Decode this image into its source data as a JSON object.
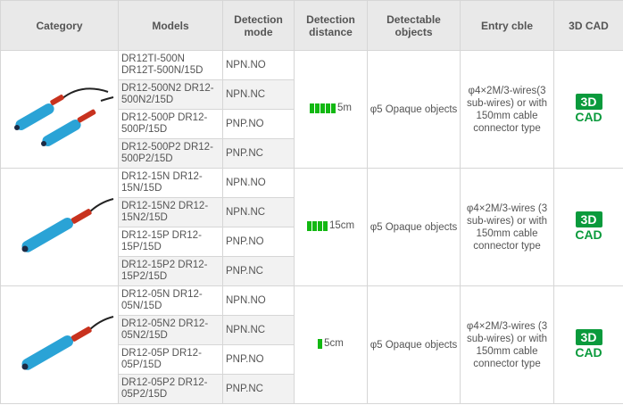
{
  "headers": {
    "category": "Category",
    "models": "Models",
    "mode": "Detection mode",
    "distance": "Detection distance",
    "objects": "Detectable objects",
    "entry": "Entry cble",
    "cad": "3D CAD"
  },
  "groups": [
    {
      "distance": "5m",
      "bar_level": 5,
      "objects": "φ5 Opaque objects",
      "entry": "φ4×2M/3-wires(3 sub-wires) or with 150mm cable connector type",
      "cad_top": "3D",
      "cad_bottom": "CAD",
      "rows": [
        {
          "model": "DR12TI-500N DR12T-500N/15D",
          "mode": "NPN.NO"
        },
        {
          "model": "DR12-500N2 DR12-500N2/15D",
          "mode": "NPN.NC"
        },
        {
          "model": "DR12-500P DR12-500P/15D",
          "mode": "PNP.NO"
        },
        {
          "model": "DR12-500P2 DR12-500P2/15D",
          "mode": "PNP.NC"
        }
      ]
    },
    {
      "distance": "15cm",
      "bar_level": 4,
      "objects": "φ5 Opaque objects",
      "entry": "φ4×2M/3-wires (3 sub-wires) or with 150mm cable connector type",
      "cad_top": "3D",
      "cad_bottom": "CAD",
      "rows": [
        {
          "model": "DR12-15N DR12-15N/15D",
          "mode": "NPN.NO"
        },
        {
          "model": "DR12-15N2 DR12-15N2/15D",
          "mode": "NPN.NC"
        },
        {
          "model": "DR12-15P DR12-15P/15D",
          "mode": "PNP.NO"
        },
        {
          "model": "DR12-15P2 DR12-15P2/15D",
          "mode": "PNP.NC"
        }
      ]
    },
    {
      "distance": "5cm",
      "bar_level": 1,
      "objects": "φ5 Opaque objects",
      "entry": "φ4×2M/3-wires (3 sub-wires) or with 150mm cable connector type",
      "cad_top": "3D",
      "cad_bottom": "CAD",
      "rows": [
        {
          "model": "DR12-05N DR12-05N/15D",
          "mode": "NPN.NO"
        },
        {
          "model": "DR12-05N2 DR12-05N2/15D",
          "mode": "NPN.NC"
        },
        {
          "model": "DR12-05P DR12-05P/15D",
          "mode": "PNP.NO"
        },
        {
          "model": "DR12-05P2 DR12-05P2/15D",
          "mode": "PNP.NC"
        }
      ]
    }
  ],
  "colors": {
    "bar": "#12b812",
    "cad": "#0a9a3c",
    "sensor_body": "#2aa3d6",
    "cable": "#c8321e"
  }
}
